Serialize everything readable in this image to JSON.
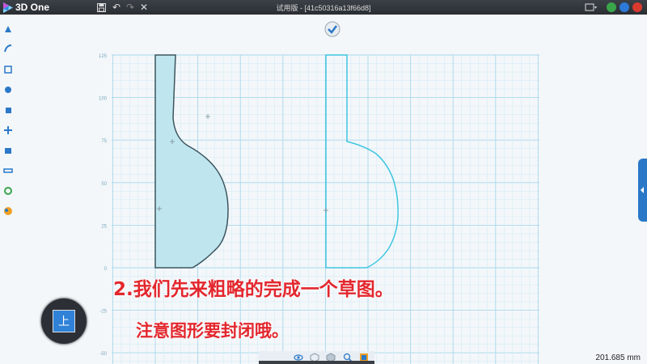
{
  "app": {
    "name": "3D One",
    "window_title": "试用版 - [41c50316a13f66d8]"
  },
  "toolbar": {
    "icons": [
      "save-icon",
      "undo-icon",
      "redo-icon",
      "close-sketch-icon"
    ],
    "glyphs": {
      "save": "💾",
      "undo": "↶",
      "redo": "↷",
      "close": "✕"
    }
  },
  "left_toolbar": {
    "icons": [
      "basic-solid-icon",
      "sketch-icon",
      "draw-curve-icon",
      "special-feature-icon",
      "basic-edit-icon",
      "move-icon",
      "combine-icon",
      "measure-icon",
      "color-icon",
      "material-icon"
    ]
  },
  "grid": {
    "y_axis_labels": [
      "125",
      "100",
      "75",
      "50",
      "25",
      "0",
      "-25",
      "-50"
    ]
  },
  "viewcube": {
    "face_label": "上"
  },
  "overlay": {
    "line1": "2.我们先来粗略的完成一个草图。",
    "line2": "注意图形要封闭哦。"
  },
  "bottom_bar": {
    "icons": [
      "view-icon",
      "cube-wire-icon",
      "cube-solid-icon",
      "zoom-icon",
      "fit-view-icon"
    ]
  },
  "status": {
    "scale": "201.685 mm"
  },
  "colors": {
    "accent": "#2f82d8",
    "sketch_fill": "#bfe6ee",
    "sketch_line": "#3fc6e0",
    "note_red": "#e3272e"
  }
}
